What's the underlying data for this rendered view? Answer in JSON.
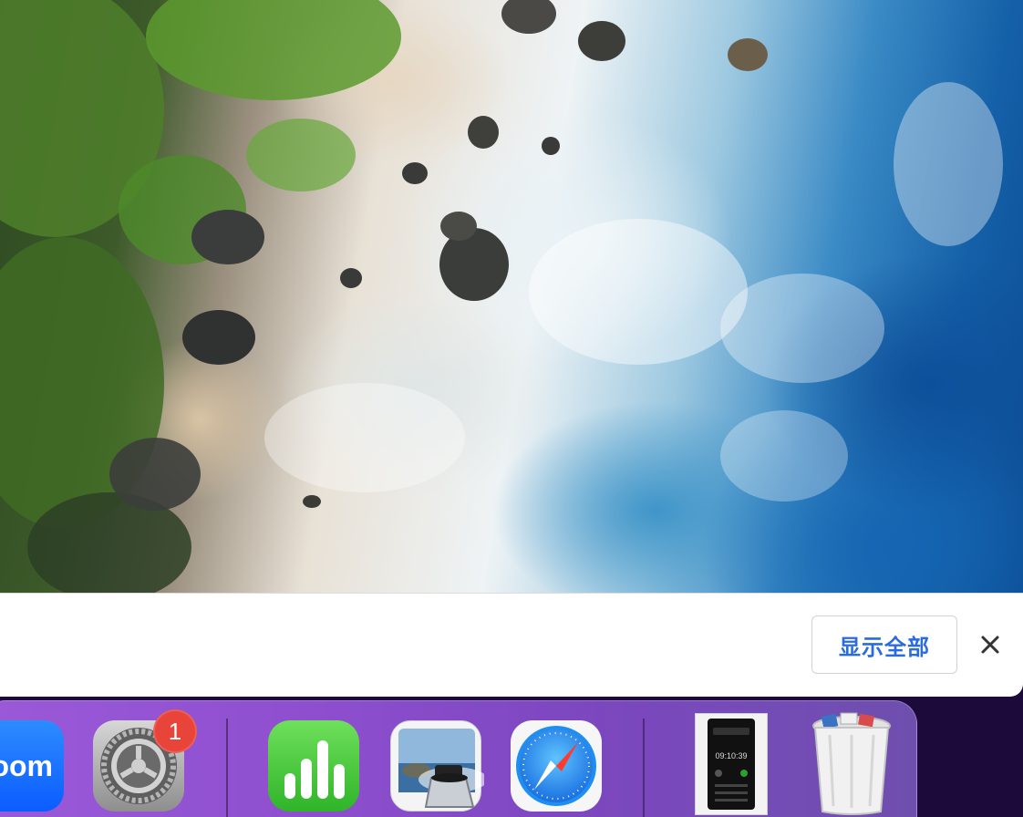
{
  "notification_bar": {
    "show_all_label": "显示全部"
  },
  "dock": {
    "apps": [
      {
        "name": "Zoom",
        "icon": "zoom-icon",
        "label_fragment": "oom"
      },
      {
        "name": "System Settings",
        "icon": "gear-icon",
        "badge": "1"
      },
      {
        "name": "Numbers",
        "icon": "bar-chart-icon"
      },
      {
        "name": "Preview",
        "icon": "preview-icon"
      },
      {
        "name": "Safari",
        "icon": "compass-icon"
      },
      {
        "name": "Document",
        "icon": "document-thumbnail-icon",
        "thumbnail_text": "09:10:39"
      },
      {
        "name": "Trash",
        "icon": "trash-icon"
      }
    ]
  },
  "colors": {
    "accent": "#2a6be0",
    "badge": "#e8443a",
    "dock": "#8e4fcf"
  }
}
